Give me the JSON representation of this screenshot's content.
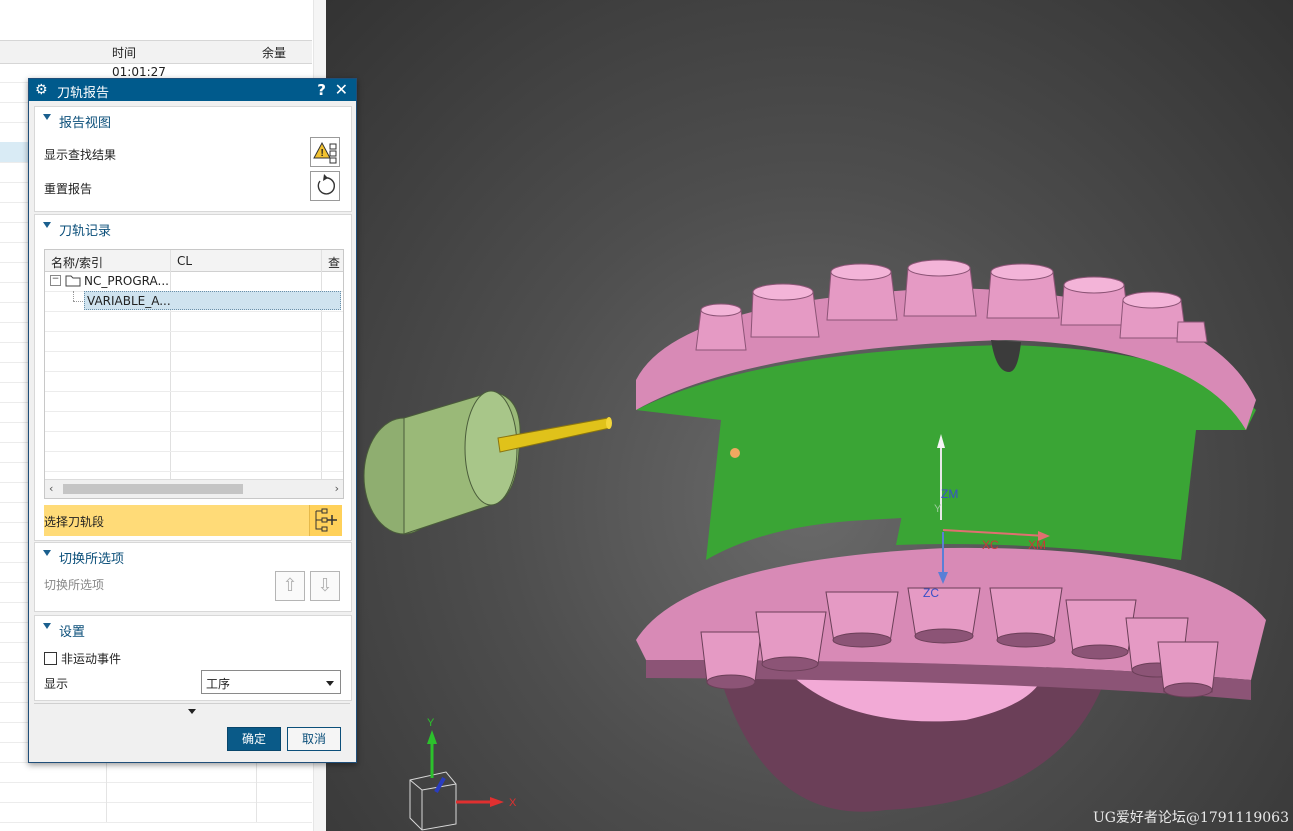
{
  "background_table": {
    "col_time": "时间",
    "col_stock": "余量",
    "first_time": "01:01:27"
  },
  "dialog": {
    "title": "刀轨报告",
    "help": "?",
    "close": "✕",
    "report_view": {
      "header": "报告视图",
      "show_results": "显示查找结果",
      "reset_report": "重置报告"
    },
    "toolpath_records": {
      "header": "刀轨记录",
      "columns": [
        "名称/索引",
        "CL",
        "查"
      ],
      "rows": [
        {
          "name": "NC_PROGRA..."
        },
        {
          "name": "VARIABLE_A..."
        }
      ],
      "select_segment": "选择刀轨段"
    },
    "toggle_selection": {
      "header": "切换所选项",
      "label": "切换所选项"
    },
    "settings": {
      "header": "设置",
      "non_motion_events": "非运动事件",
      "non_motion_checked": false,
      "display_label": "显示",
      "display_value": "工序"
    },
    "ok": "确定",
    "cancel": "取消"
  },
  "viewport": {
    "axis_labels": {
      "zm": "ZM",
      "y": "Y",
      "xc": "XC",
      "xm": "XM",
      "zc": "ZC"
    },
    "triad_labels": {
      "x": "X",
      "y": "Y"
    },
    "watermark": "UG爱好者论坛@1791119063"
  },
  "colors": {
    "title_bar": "#005a8c",
    "part_pink": "#e59ac4",
    "floor_green": "#3aa535",
    "tool_green": "#9ab978",
    "tool_yellow": "#e0c21a",
    "highlight": "#ffdb78"
  }
}
